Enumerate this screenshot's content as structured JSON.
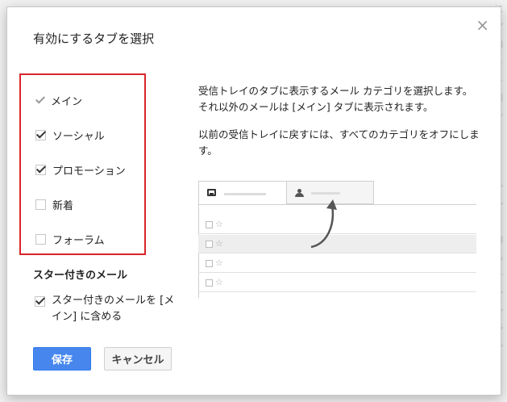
{
  "dialog": {
    "title": "有効にするタブを選択",
    "close_glyph": "×"
  },
  "tabs": [
    {
      "label": "メイン",
      "state": "fixed-checked"
    },
    {
      "label": "ソーシャル",
      "state": "checked"
    },
    {
      "label": "プロモーション",
      "state": "checked"
    },
    {
      "label": "新着",
      "state": "unchecked"
    },
    {
      "label": "フォーラム",
      "state": "unchecked"
    }
  ],
  "starred": {
    "heading": "スター付きのメール",
    "option_label": "スター付きのメールを [メイン] に含める",
    "checked": true
  },
  "description": {
    "paragraph1": "受信トレイのタブに表示するメール カテゴリを選択します。それ以外のメールは [メイン] タブに表示されます。",
    "paragraph2": "以前の受信トレイに戻すには、すべてのカテゴリをオフにします。"
  },
  "illustration": {
    "tab1_icon": "inbox-icon",
    "tab2_icon": "people-icon",
    "rows": [
      "☐ ☆",
      "☐ ☆",
      "☐ ☆",
      "☐ ☆"
    ]
  },
  "buttons": {
    "save_label": "保存",
    "cancel_label": "キャンセル"
  },
  "colors": {
    "save_button": "#4787ed",
    "highlight_box": "#d9252a"
  }
}
